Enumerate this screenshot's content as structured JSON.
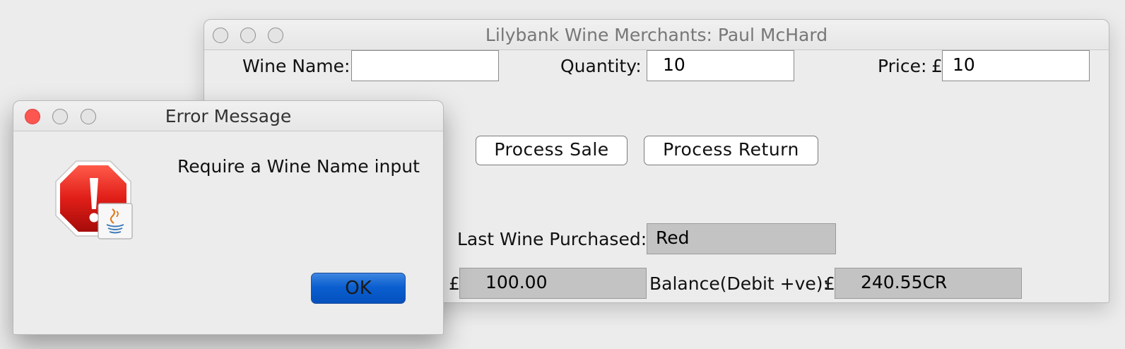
{
  "main_window": {
    "title": "Lilybank Wine Merchants: Paul McHard",
    "wine_name_label": "Wine Name:",
    "wine_name_value": "",
    "quantity_label": "Quantity:",
    "quantity_value": "10",
    "price_label": "Price:",
    "price_currency": "£",
    "price_value": "10",
    "process_sale_label": "Process Sale",
    "process_return_label": "Process Return",
    "last_wine_label": "Last Wine Purchased:",
    "last_wine_value": "Red",
    "amount_currency": "£",
    "amount_value": "100.00",
    "balance_label": "Balance(Debit +ve):",
    "balance_currency": "£",
    "balance_value": "240.55CR"
  },
  "dialog": {
    "title": "Error Message",
    "message": "Require a Wine Name input",
    "ok_label": "OK",
    "icon": "error-java-icon",
    "accent_color": "#0a5bcc"
  }
}
